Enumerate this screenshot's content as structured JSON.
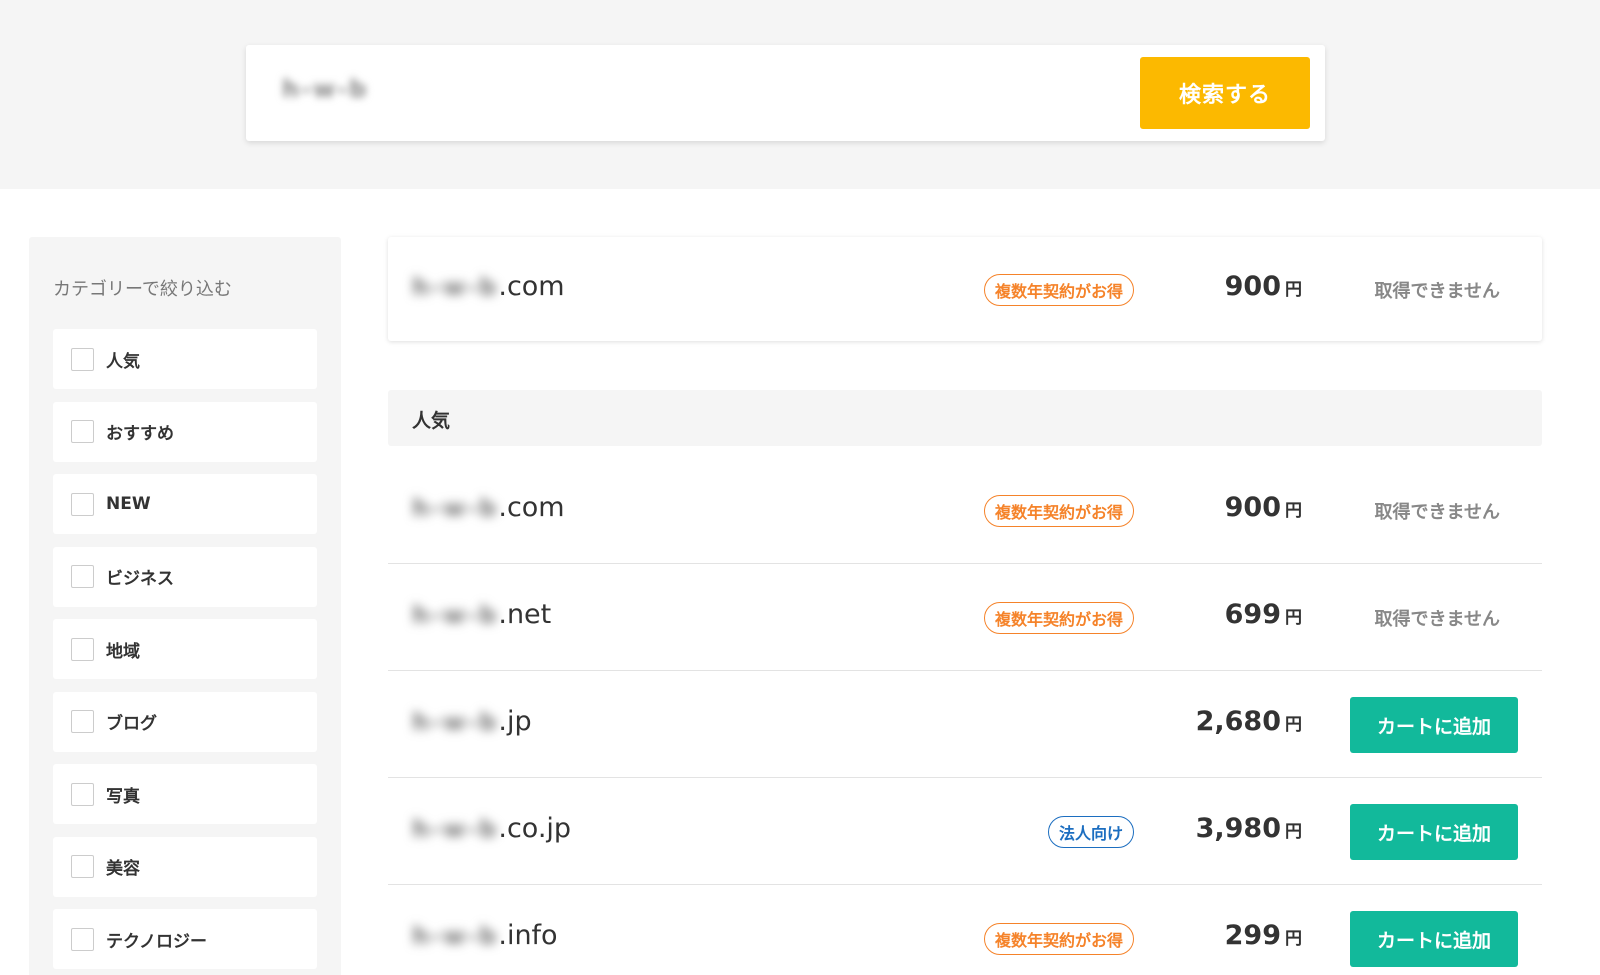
{
  "search": {
    "query": "h-w-b",
    "button_label": "検索する"
  },
  "sidebar": {
    "title": "カテゴリーで絞り込む",
    "categories": [
      {
        "label": "人気",
        "checked": false
      },
      {
        "label": "おすすめ",
        "checked": false
      },
      {
        "label": "NEW",
        "checked": false
      },
      {
        "label": "ビジネス",
        "checked": false
      },
      {
        "label": "地域",
        "checked": false
      },
      {
        "label": "ブログ",
        "checked": false
      },
      {
        "label": "写真",
        "checked": false
      },
      {
        "label": "美容",
        "checked": false
      },
      {
        "label": "テクノロジー",
        "checked": false
      }
    ]
  },
  "featured": {
    "name": "h-w-b",
    "tld": ".com",
    "badge": "複数年契約がお得",
    "price": "900",
    "currency": "円",
    "status": "取得できません"
  },
  "section": {
    "title": "人気"
  },
  "results": [
    {
      "name": "h-w-b",
      "tld": ".com",
      "badge": "複数年契約がお得",
      "badge_type": "orange",
      "price": "900",
      "currency": "円",
      "status": "取得できません",
      "action": ""
    },
    {
      "name": "h-w-b",
      "tld": ".net",
      "badge": "複数年契約がお得",
      "badge_type": "orange",
      "price": "699",
      "currency": "円",
      "status": "取得できません",
      "action": ""
    },
    {
      "name": "h-w-b",
      "tld": ".jp",
      "badge": "",
      "badge_type": "",
      "price": "2,680",
      "currency": "円",
      "status": "",
      "action": "カートに追加"
    },
    {
      "name": "h-w-b",
      "tld": ".co.jp",
      "badge": "法人向け",
      "badge_type": "blue",
      "price": "3,980",
      "currency": "円",
      "status": "",
      "action": "カートに追加"
    },
    {
      "name": "h-w-b",
      "tld": ".info",
      "badge": "複数年契約がお得",
      "badge_type": "orange",
      "price": "299",
      "currency": "円",
      "status": "",
      "action": "カートに追加"
    }
  ],
  "colors": {
    "accent_search": "#fcb900",
    "cart": "#12b99b",
    "badge_orange": "#f5832a",
    "badge_blue": "#1c6ec0"
  }
}
